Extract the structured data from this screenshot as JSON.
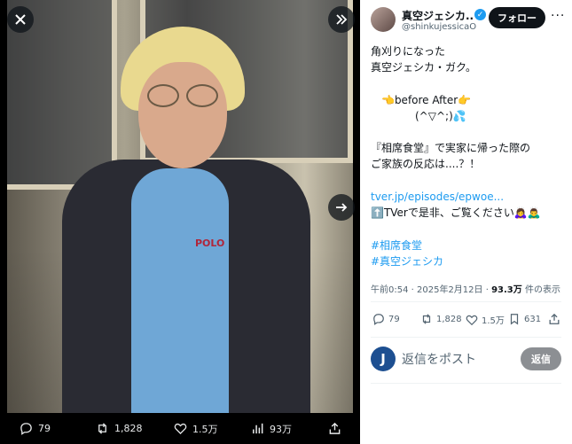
{
  "viewer": {
    "close_icon": "close-icon",
    "expand_icon": "expand-icon",
    "next_icon": "next-arrow-icon",
    "actions": {
      "replies": "79",
      "reposts": "1,828",
      "likes": "1.5万",
      "views": "93万"
    },
    "photo_text": "POLO"
  },
  "post": {
    "author": {
      "name": "真空ジェシカ...",
      "handle": "@shinkujessicaO",
      "verified": true
    },
    "follow_label": "フォロー",
    "more_label": "···",
    "lines": [
      "角刈りになった",
      "真空ジェシカ・ガク。",
      "",
      "👈before    After👉",
      "(^▽^;)💦",
      "",
      "『相席食堂』で実家に帰った際の",
      "ご家族の反応は....？！",
      ""
    ],
    "link": "tver.jp/episodes/epwoe...",
    "tver_line": "⬆️TVerで是非、ご覧ください🙇‍♀️🙇‍♂️",
    "hashtags": [
      "#相席食堂",
      "#真空ジェシカ"
    ],
    "meta": {
      "time": "午前0:54 · 2025年2月12日 · ",
      "views": "93.3万",
      "views_suffix": " 件の表示"
    },
    "stats": {
      "replies": "79",
      "reposts": "1,828",
      "likes": "1.5万",
      "bookmarks": "631"
    },
    "reply": {
      "avatar_letter": "J",
      "placeholder": "返信をポスト",
      "button": "返信"
    }
  },
  "colors": {
    "accent": "#1d9bf0",
    "text": "#0f1419",
    "muted": "#536471"
  }
}
